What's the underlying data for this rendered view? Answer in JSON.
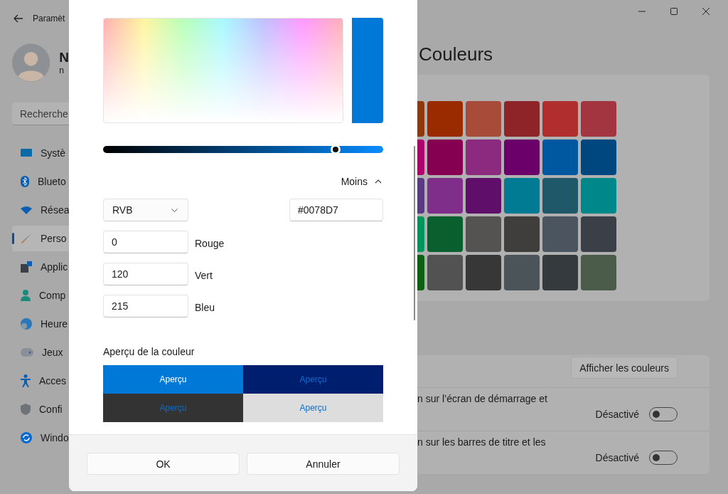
{
  "window": {
    "title": "Paramèt"
  },
  "account": {
    "name": "N",
    "email": "n"
  },
  "search": {
    "placeholder": "Recherche"
  },
  "sidebar": {
    "items": [
      {
        "label": "Systè",
        "kind": "system",
        "selected": false
      },
      {
        "label": "Blueto",
        "kind": "bluetooth",
        "selected": false
      },
      {
        "label": "Résea",
        "kind": "network",
        "selected": false
      },
      {
        "label": "Perso",
        "kind": "brush",
        "selected": true
      },
      {
        "label": "Applic",
        "kind": "apps",
        "selected": false
      },
      {
        "label": "Comp",
        "kind": "person",
        "selected": false
      },
      {
        "label": "Heure",
        "kind": "clock",
        "selected": false
      },
      {
        "label": "Jeux",
        "kind": "gamepad",
        "selected": false
      },
      {
        "label": "Acces",
        "kind": "accessibility",
        "selected": false
      },
      {
        "label": "Confi",
        "kind": "shield",
        "selected": false
      },
      {
        "label": "Windo",
        "kind": "update",
        "selected": false
      }
    ]
  },
  "page": {
    "title": "Couleurs",
    "swatch_rows": [
      {
        "swatches": [
          {
            "color": "#8e3a0c"
          },
          {
            "color": "#9a2a00"
          },
          {
            "color": "#a84b38"
          },
          {
            "color": "#8e2428"
          },
          {
            "color": "#b02e2e"
          },
          {
            "color": "#a23540"
          }
        ]
      },
      {
        "swatches": [
          {
            "color": "#b0006c"
          },
          {
            "color": "#860051"
          },
          {
            "color": "#8b2a7f"
          },
          {
            "color": "#6b006a"
          },
          {
            "color": "#0058a0"
          },
          {
            "color": "#00477f"
          }
        ]
      },
      {
        "swatches": [
          {
            "color": "#5a3a85"
          },
          {
            "color": "#7f2f8a"
          },
          {
            "color": "#5f0f6a"
          },
          {
            "color": "#007b93"
          },
          {
            "color": "#1f5868"
          },
          {
            "color": "#008789"
          }
        ]
      },
      {
        "swatches": [
          {
            "color": "#00955a"
          },
          {
            "color": "#0a5f2e"
          },
          {
            "color": "#545351"
          },
          {
            "color": "#403e3d"
          },
          {
            "color": "#4b5560"
          },
          {
            "color": "#3a3f48"
          }
        ]
      },
      {
        "swatches": [
          {
            "color": "#0b6012"
          },
          {
            "color": "#525252"
          },
          {
            "color": "#383737"
          },
          {
            "color": "#4a5459"
          },
          {
            "color": "#353b3d"
          },
          {
            "color": "#4b5c4a"
          }
        ]
      }
    ],
    "show_colors_button": "Afficher les couleurs",
    "settings": [
      {
        "text": "n sur l’écran de démarrage et",
        "state": "Désactivé",
        "on": false
      },
      {
        "text": "n sur les barres de titre et les",
        "state": "Désactivé",
        "on": false
      }
    ]
  },
  "dialog": {
    "value_slider": {
      "level": 0.83
    },
    "expander": {
      "label": "Moins",
      "expanded": true
    },
    "model_dropdown": {
      "value": "RVB"
    },
    "hex_field": {
      "value": "#0078D7"
    },
    "channels": [
      {
        "value": "0",
        "label": "Rouge"
      },
      {
        "value": "120",
        "label": "Vert"
      },
      {
        "value": "215",
        "label": "Bleu"
      }
    ],
    "preview": {
      "title": "Aperçu de la couleur",
      "cells": [
        {
          "label": "Aperçu",
          "color": "#0078d7",
          "kind": "light_text"
        },
        {
          "label": "Aperçu",
          "color": "#001e6e",
          "kind": "accent_text"
        },
        {
          "label": "Aperçu",
          "color": "#333333",
          "kind": "accent_text"
        },
        {
          "label": "Aperçu",
          "color": "#dddddd",
          "kind": "accent_text"
        }
      ]
    },
    "buttons": [
      {
        "label": "OK"
      },
      {
        "label": "Annuler"
      }
    ]
  }
}
